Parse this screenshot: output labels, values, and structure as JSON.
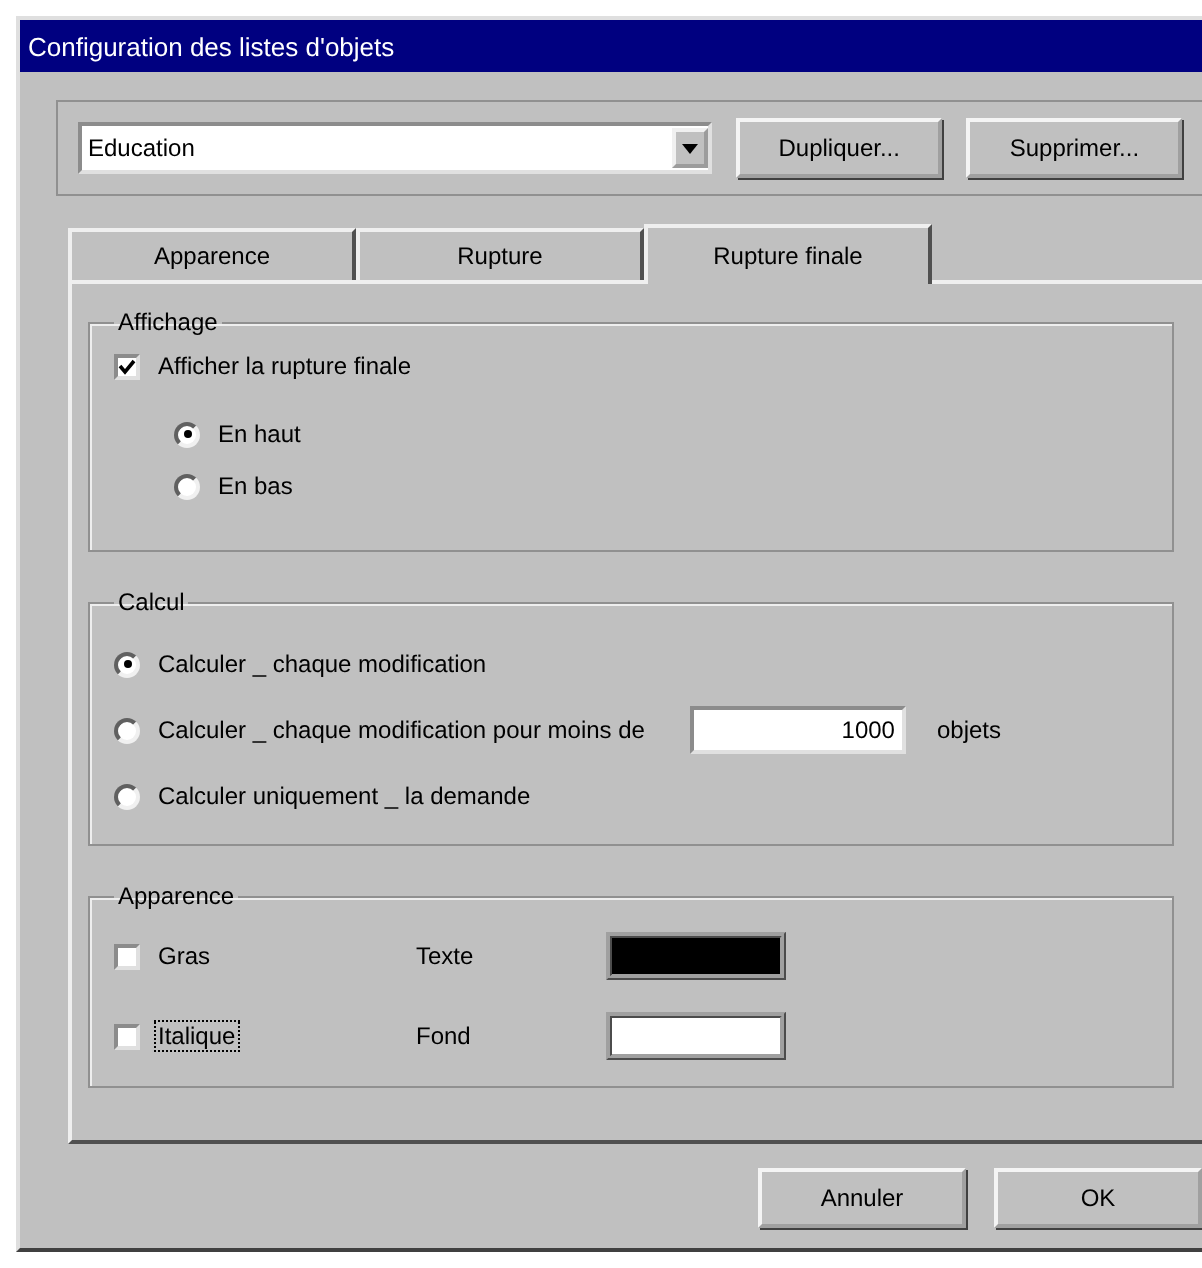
{
  "window": {
    "title": "Configuration des listes d'objets"
  },
  "list_selector": {
    "value": "Education"
  },
  "top_buttons": [
    "Dupliquer...",
    "Supprimer..."
  ],
  "tabs": [
    {
      "label": "Apparence",
      "selected": false
    },
    {
      "label": "Rupture",
      "selected": false
    },
    {
      "label": "Rupture finale",
      "selected": true
    }
  ],
  "affichage": {
    "title": "Affichage",
    "show_final_break": {
      "label": "Afficher la rupture finale",
      "checked": true
    },
    "position": [
      {
        "label": "En haut",
        "selected": true
      },
      {
        "label": "En bas",
        "selected": false
      }
    ]
  },
  "calcul": {
    "title": "Calcul",
    "options": [
      {
        "kind": "plain",
        "label": "Calculer _ chaque modification",
        "selected": true
      },
      {
        "kind": "threshold",
        "label": "Calculer _ chaque modification pour moins de",
        "value": "1000",
        "unit": "objets",
        "selected": false
      },
      {
        "kind": "plain",
        "label": "Calculer uniquement _ la demande",
        "selected": false
      }
    ]
  },
  "apparence": {
    "title": "Apparence",
    "styles": [
      {
        "label": "Gras",
        "checked": false,
        "focused": false
      },
      {
        "label": "Italique",
        "checked": false,
        "focused": true
      }
    ],
    "colors": [
      {
        "label": "Texte",
        "color": "#000000"
      },
      {
        "label": "Fond",
        "color": "#ffffff"
      }
    ]
  },
  "buttons": [
    "Annuler",
    "OK"
  ]
}
